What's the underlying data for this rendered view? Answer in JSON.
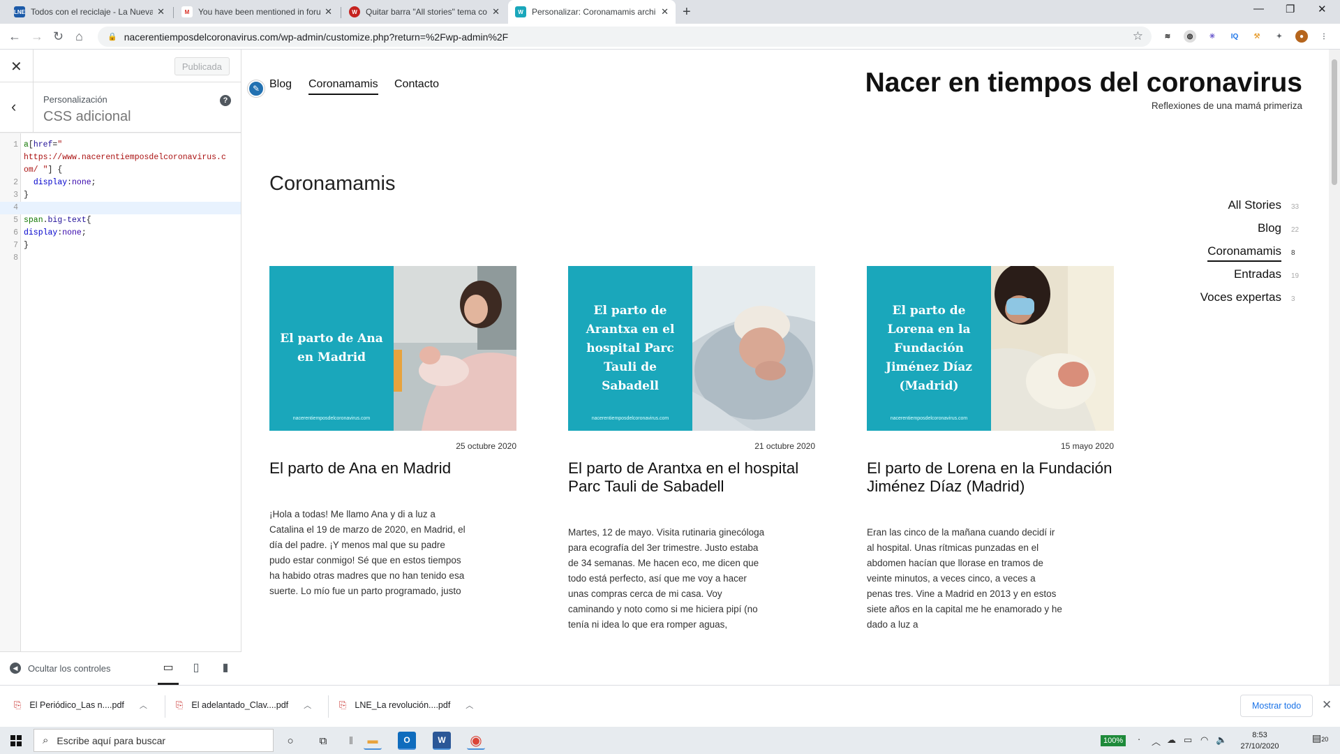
{
  "browser": {
    "tabs": [
      {
        "title": "Todos con el reciclaje - La Nueva",
        "icon": "LNE",
        "icon_color": "#1c5aa8"
      },
      {
        "title": "You have been mentioned in foru",
        "icon": "M",
        "icon_color": "#d93025"
      },
      {
        "title": "Quitar barra \"All stories\" tema co",
        "icon": "W",
        "icon_color": "#c5221f"
      },
      {
        "title": "Personalizar: Coronamamis archi",
        "icon": "W",
        "icon_color": "#1aa7bb",
        "active": true
      }
    ],
    "url": "nacerentiemposdelcoronavirus.com/wp-admin/customize.php?return=%2Fwp-admin%2F"
  },
  "customizer": {
    "published_label": "Publicada",
    "section_sub": "Personalización",
    "section_title": "CSS adicional",
    "hide_controls": "Ocultar los controles",
    "code_lines": [
      "1",
      "2",
      "3",
      "4",
      "5",
      "6",
      "7",
      "8"
    ]
  },
  "site": {
    "nav": [
      "Blog",
      "Coronamamis",
      "Contacto"
    ],
    "title": "Nacer en tiempos del coronavirus",
    "tagline": "Reflexiones de una mamá primeriza",
    "page_title": "Coronamamis",
    "categories": [
      {
        "name": "All Stories",
        "count": "33"
      },
      {
        "name": "Blog",
        "count": "22"
      },
      {
        "name": "Coronamamis",
        "count": "8",
        "current": true
      },
      {
        "name": "Entradas",
        "count": "19"
      },
      {
        "name": "Voces expertas",
        "count": "3"
      }
    ],
    "posts": [
      {
        "image_text": "El parto de Ana en Madrid",
        "image_url": "nacerentiemposdelcoronavirus.com",
        "date": "25 octubre 2020",
        "title": "El parto de Ana en Madrid",
        "excerpt": "¡Hola a todas! Me llamo Ana y di a luz a Catalina el 19 de marzo de 2020, en Madrid, el día del padre. ¡Y menos mal que su padre pudo estar conmigo! Sé que en estos tiempos ha habido otras madres que no han tenido esa suerte. Lo mío fue un parto programado, justo"
      },
      {
        "image_text": "El parto de Arantxa en el hospital Parc Tauli de Sabadell",
        "image_url": "nacerentiemposdelcoronavirus.com",
        "date": "21 octubre 2020",
        "title": "El parto de Arantxa en el hospital Parc Tauli de Sabadell",
        "excerpt": "Martes, 12 de mayo. Visita rutinaria ginecóloga para ecografía del 3er trimestre. Justo estaba de 34 semanas. Me hacen eco, me dicen que todo está perfecto, así que me voy a hacer unas compras cerca de mi casa. Voy caminando y noto como si me hiciera pipí (no tenía ni idea lo que era romper aguas,"
      },
      {
        "image_text": "El parto de Lorena en la Fundación Jiménez Díaz (Madrid)",
        "image_url": "nacerentiemposdelcoronavirus.com",
        "date": "15 mayo 2020",
        "title": "El parto de Lorena en la Fundación Jiménez Díaz (Madrid)",
        "excerpt": "Eran las cinco de la mañana cuando decidí ir al hospital. Unas rítmicas punzadas en el abdomen hacían que llorase en tramos de veinte minutos, a veces cinco, a veces a penas tres. Vine a Madrid en 2013 y en estos siete años en la capital me he enamorado y he dado a luz a"
      }
    ]
  },
  "downloads": {
    "items": [
      "El Periódico_Las n....pdf",
      "El adelantado_Clav....pdf",
      "LNE_La revolución....pdf"
    ],
    "show_all": "Mostrar todo"
  },
  "taskbar": {
    "search_placeholder": "Escribe aquí para buscar",
    "battery": "100%",
    "time": "8:53",
    "date": "27/10/2020",
    "notifications": "20"
  }
}
